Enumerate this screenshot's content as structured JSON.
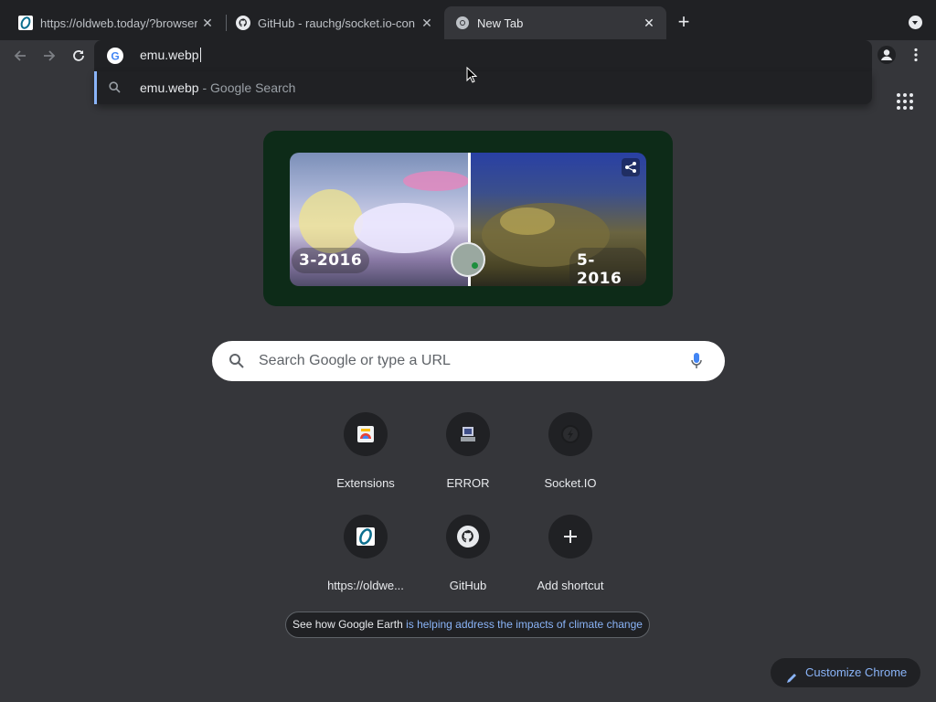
{
  "tabs": [
    {
      "title": "https://oldweb.today/?browser",
      "icon": "oldweb-icon",
      "active": false
    },
    {
      "title": "GitHub - rauchg/socket.io-con",
      "icon": "github-icon",
      "active": false
    },
    {
      "title": "New Tab",
      "icon": "chrome-icon",
      "active": true
    }
  ],
  "omnibox": {
    "text": "emu.webp",
    "suggestion_bold": "emu.webp",
    "suggestion_rest": " - Google Search"
  },
  "doodle": {
    "left_label": "3-2016",
    "right_label": "5-2016"
  },
  "search": {
    "placeholder": "Search Google or type a URL"
  },
  "shortcuts": [
    {
      "label": "Extensions",
      "icon": "extensions-icon"
    },
    {
      "label": "ERROR",
      "icon": "error-icon"
    },
    {
      "label": "Socket.IO",
      "icon": "socketio-icon"
    },
    {
      "label": "https://oldwe...",
      "icon": "oldweb-icon"
    },
    {
      "label": "GitHub",
      "icon": "github-icon"
    },
    {
      "label": "Add shortcut",
      "icon": "plus-icon"
    }
  ],
  "promo": {
    "text_plain": "See how Google Earth ",
    "text_link": "is helping address the impacts of climate change"
  },
  "customize": {
    "label": "Customize Chrome"
  },
  "colors": {
    "accent": "#8ab4f8",
    "background": "#35363a",
    "tabstrip": "#202124"
  }
}
